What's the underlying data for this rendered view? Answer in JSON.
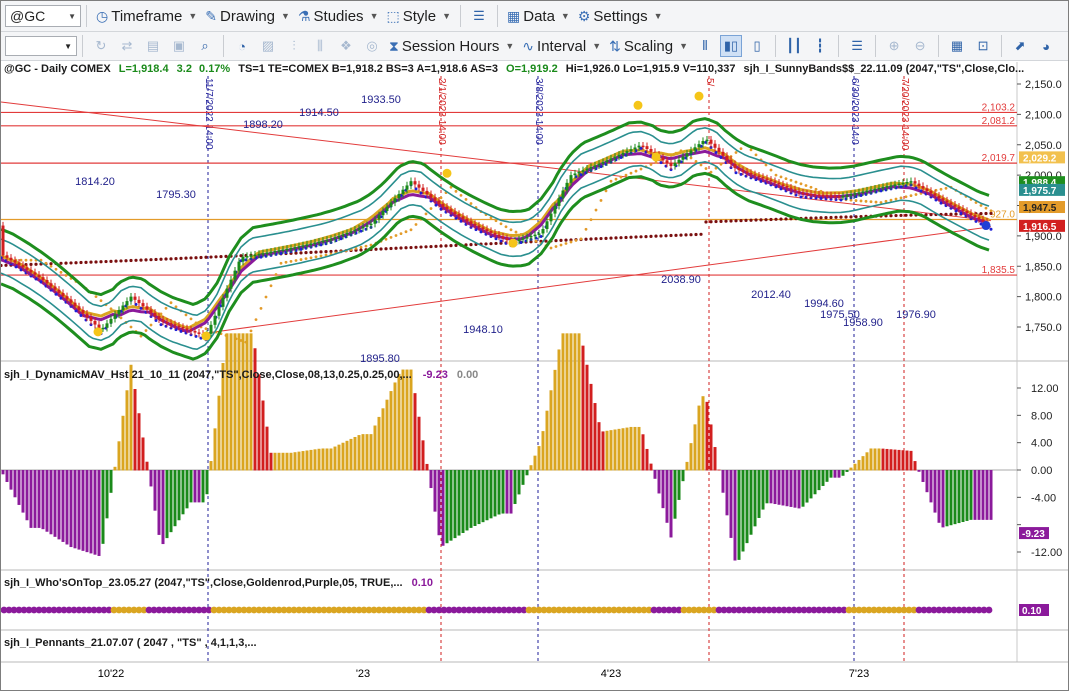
{
  "toolbar1": {
    "symbol": "@GC",
    "timeframe": "Timeframe",
    "drawing": "Drawing",
    "studies": "Studies",
    "style": "Style",
    "data": "Data",
    "settings": "Settings"
  },
  "toolbar2": {
    "session_hours": "Session Hours",
    "interval": "Interval",
    "scaling": "Scaling"
  },
  "header": {
    "symbol": "@GC - Daily  COMEX",
    "last": "L=1,918.4",
    "change": "3.2",
    "pct": "0.17%",
    "rest": "TS=1  TE=COMEX  B=1,918.2  BS=3  A=1,918.6  AS=3",
    "open": "O=1,919.2",
    "ohlv": "Hi=1,926.0  Lo=1,915.9  V=110,337",
    "study": "sjh_I_SunnyBands$$_22.11.09 (2047,\"TS\",Close,Clo..."
  },
  "colors": {
    "up_bar": "#1a8a1a",
    "down_bar": "#d21f1f",
    "goldenrod": "#daa520",
    "purple": "#8b1a9b",
    "band_green": "#1e8e1e",
    "band_teal": "#2a8f8f",
    "dots_blue": "#1f1fd6",
    "dots_orange": "#e39b2a",
    "dots_maroon": "#7a0f0f",
    "resistance": "#e23b3b",
    "axis_text": "#222222"
  },
  "price_axis": {
    "ticks": [
      "2,150.0",
      "2,100.0",
      "2,050.0",
      "2,000.0",
      "1,950.0",
      "1,900.0",
      "1,850.0",
      "1,800.0",
      "1,750.0"
    ],
    "levels": [
      {
        "label": "2,103.2",
        "color": "#e23b3b"
      },
      {
        "label": "2,081.2",
        "color": "#e23b3b"
      },
      {
        "label": "2,019.7",
        "color": "#e23b3b"
      },
      {
        "label": "927.0",
        "color": "#e39b2a"
      },
      {
        "label": "1,835.5",
        "color": "#e23b3b"
      }
    ],
    "badges": [
      {
        "label": "2,029.2",
        "color": "#f2c14e",
        "text_color": "#ffffff"
      },
      {
        "label": "1,988.4",
        "color": "#1e8e1e",
        "text_color": "#ffffff"
      },
      {
        "label": "1,975.7",
        "color": "#2a8f8f",
        "text_color": "#ffffff"
      },
      {
        "label": "1,947.5",
        "color": "#e39b2a",
        "text_color": "#222222"
      },
      {
        "label": "1,916.5",
        "color": "#d21f1f",
        "text_color": "#ffffff"
      }
    ]
  },
  "price_annotations": [
    {
      "text": "1933.50"
    },
    {
      "text": "1898.20"
    },
    {
      "text": "1914.50"
    },
    {
      "text": "1814.20"
    },
    {
      "text": "1795.30"
    },
    {
      "text": "2038.90"
    },
    {
      "text": "2012.40"
    },
    {
      "text": "1994.60"
    },
    {
      "text": "1975.50"
    },
    {
      "text": "1958.90"
    },
    {
      "text": "1976.90"
    },
    {
      "text": "1948.10"
    },
    {
      "text": "1895.80"
    }
  ],
  "vertical_markers": [
    {
      "text": "11/7/2022 14:00",
      "color": "#1f1f9a"
    },
    {
      "text": "2/1/2023 14:00",
      "color": "#d21f1f"
    },
    {
      "text": "3/8/2023 14:00",
      "color": "#1f1f9a"
    },
    {
      "text": "5/",
      "color": "#d21f1f"
    },
    {
      "text": "6/30/2023 14:0",
      "color": "#1f1f9a"
    },
    {
      "text": "7/20/2023 14:00",
      "color": "#d21f1f"
    }
  ],
  "panel2": {
    "title": "sjh_I_DynamicMAV_Hst 21_10_11 (2047,\"TS\",Close,Close,08,13,0.25,0.25,00,...",
    "value1": "-9.23",
    "value2": "0.00",
    "ticks": [
      "12.00",
      "8.00",
      "4.00",
      "0.00",
      "-4.00",
      "-8.00",
      "-12.00"
    ],
    "badge": "-9.23"
  },
  "panel3": {
    "title": "sjh_I_Who'sOnTop_23.05.27 (2047,\"TS\",Close,Goldenrod,Purple,05,  TRUE,...",
    "value": "0.10",
    "badge": "0.10"
  },
  "panel4": {
    "title": "sjh_I_Pennants_21.07.07 ( 2047 , \"TS\" , 4,1,1,3,..."
  },
  "time_axis": [
    "10'22",
    "'23",
    "4'23",
    "7'23"
  ]
}
